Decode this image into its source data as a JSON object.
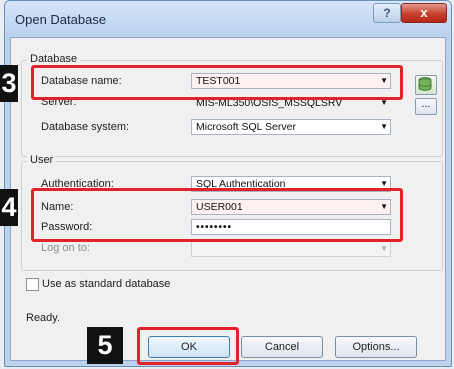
{
  "window": {
    "title": "Open Database",
    "help_label": "?",
    "close_label": "x"
  },
  "database_group": {
    "title": "Database",
    "name_label": "Database name:",
    "name_value": "TEST001",
    "server_label": "Server:",
    "server_value": "MIS-ML350\\OSIS_MSSQLSRV",
    "system_label": "Database system:",
    "system_value": "Microsoft SQL Server",
    "browse_label": "..."
  },
  "user_group": {
    "title": "User",
    "auth_label": "Authentication:",
    "auth_value": "SQL Authentication",
    "name_label": "Name:",
    "name_value": "USER001",
    "password_label": "Password:",
    "password_value": "••••••••",
    "logon_label": "Log on to:",
    "logon_value": ""
  },
  "standard_db_label": "Use as standard database",
  "status_text": "Ready.",
  "buttons": {
    "ok": "OK",
    "cancel": "Cancel",
    "options": "Options..."
  },
  "markers": [
    "3",
    "4",
    "5"
  ],
  "colors": {
    "highlight": "#e0222b",
    "title_bar": "#c6dbf3",
    "close": "#c7402c"
  },
  "icons": [
    "combo-arrow-icon",
    "database-icon",
    "checkbox"
  ]
}
